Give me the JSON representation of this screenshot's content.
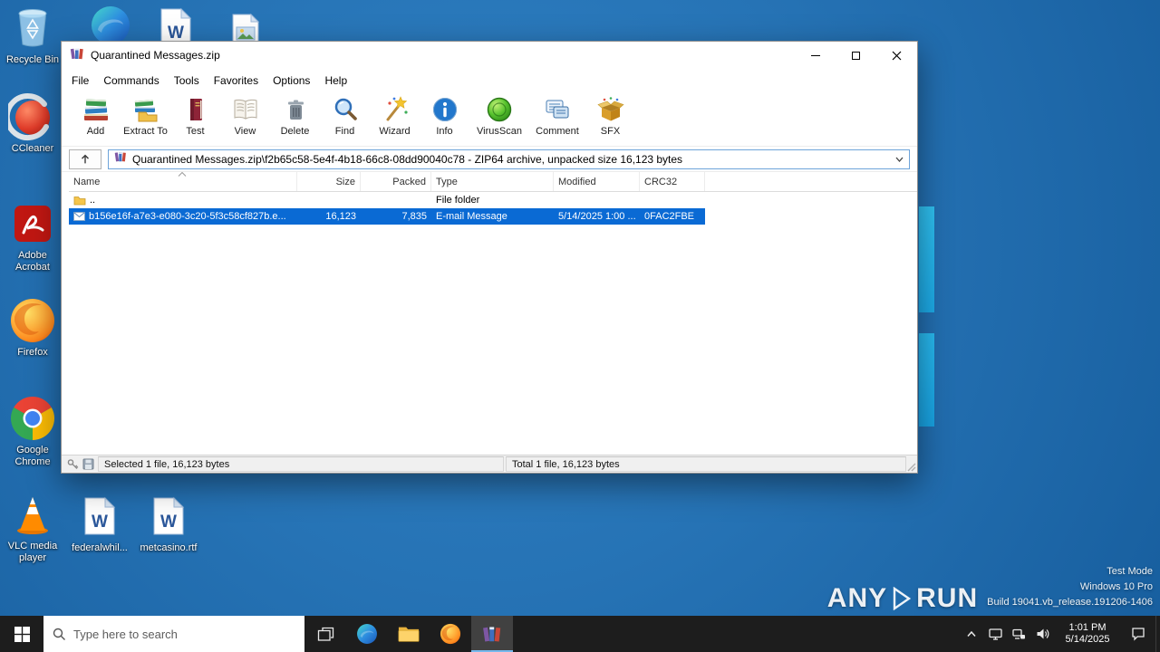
{
  "desktop": {
    "icons": [
      {
        "label": "Recycle Bin"
      },
      {
        "label": "CCleaner"
      },
      {
        "label": "Adobe Acrobat"
      },
      {
        "label": "Firefox"
      },
      {
        "label": "Google Chrome"
      },
      {
        "label": "VLC media player"
      },
      {
        "label": "federalwhil..."
      },
      {
        "label": "metcasino.rtf"
      }
    ]
  },
  "winrar": {
    "title": "Quarantined Messages.zip",
    "menu": [
      "File",
      "Commands",
      "Tools",
      "Favorites",
      "Options",
      "Help"
    ],
    "toolbar": [
      "Add",
      "Extract To",
      "Test",
      "View",
      "Delete",
      "Find",
      "Wizard",
      "Info",
      "VirusScan",
      "Comment",
      "SFX"
    ],
    "address": "Quarantined Messages.zip\\f2b65c58-5e4f-4b18-66c8-08dd90040c78 - ZIP64 archive, unpacked size 16,123 bytes",
    "columns": [
      "Name",
      "Size",
      "Packed",
      "Type",
      "Modified",
      "CRC32"
    ],
    "rows": [
      {
        "name": "..",
        "size": "",
        "packed": "",
        "type": "File folder",
        "modified": "",
        "crc32": ""
      },
      {
        "name": "b156e16f-a7e3-e080-3c20-5f3c58cf827b.e...",
        "size": "16,123",
        "packed": "7,835",
        "type": "E-mail Message",
        "modified": "5/14/2025 1:00 ...",
        "crc32": "0FAC2FBE"
      }
    ],
    "status_selected": "Selected 1 file, 16,123 bytes",
    "status_total": "Total 1 file, 16,123 bytes"
  },
  "taskbar": {
    "search_placeholder": "Type here to search",
    "clock_time": "1:01 PM",
    "clock_date": "5/14/2025"
  },
  "watermark": {
    "brand_left": "ANY",
    "brand_right": "RUN",
    "mode": "Test Mode",
    "os": "Windows 10 Pro",
    "build": "Build 19041.vb_release.191206-1406"
  },
  "colors": {
    "selection": "#0a6ad4",
    "taskbar": "#1d1d1d",
    "desktop_blue": "#2673b5",
    "accent_cyan": "#25b6ec"
  }
}
